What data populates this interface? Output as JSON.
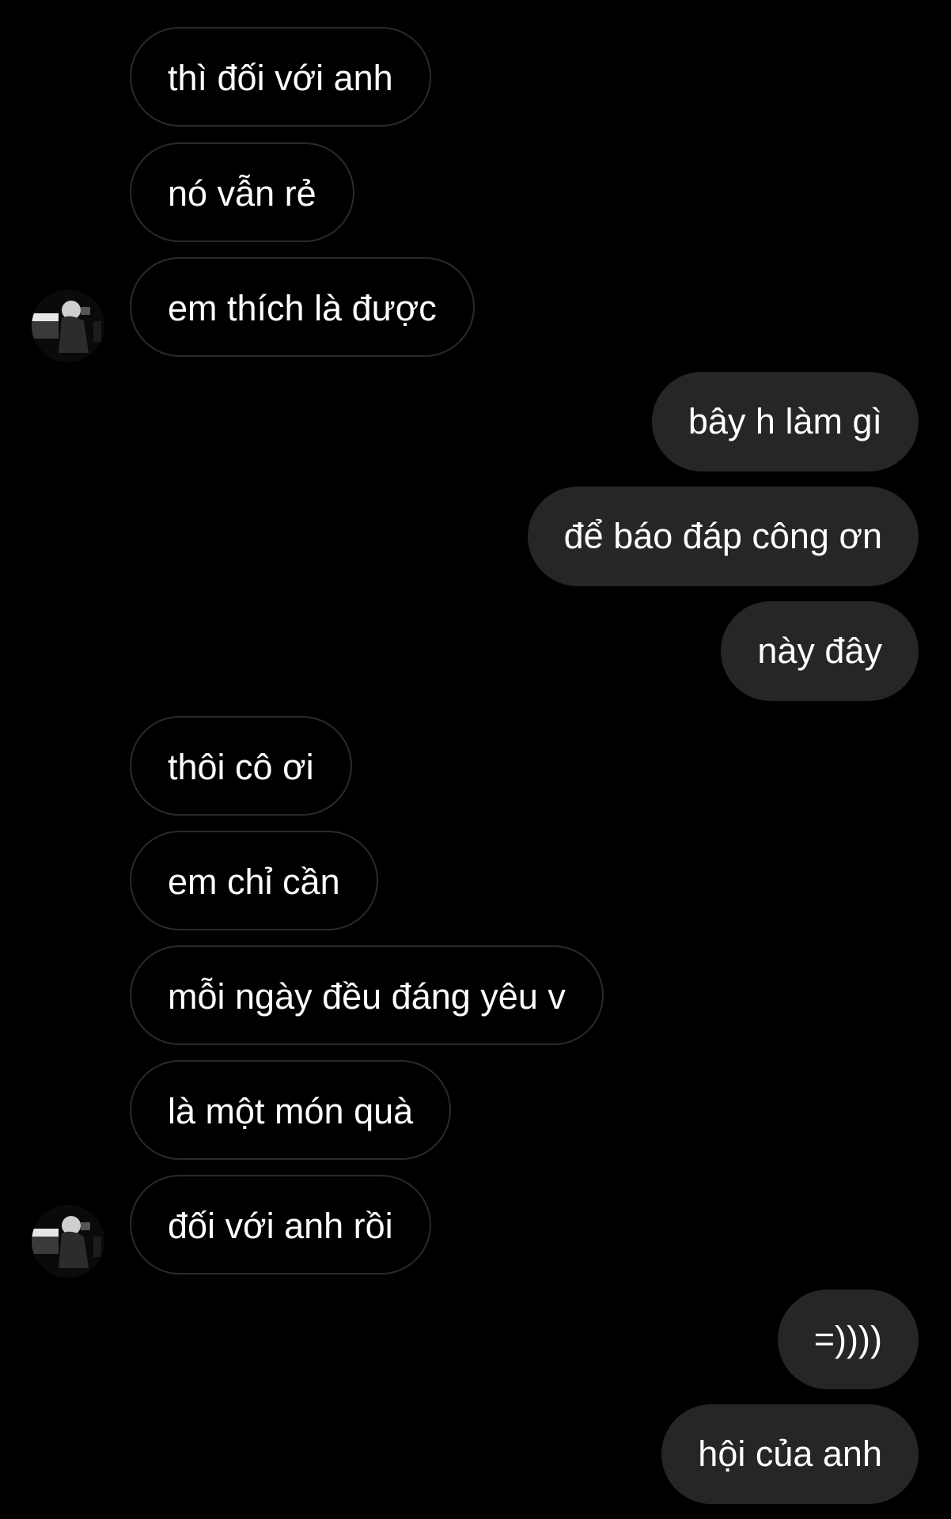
{
  "conversation": {
    "messages": [
      {
        "sender": "other",
        "text": "thì đối với anh"
      },
      {
        "sender": "other",
        "text": "nó vẫn rẻ"
      },
      {
        "sender": "other",
        "text": "em thích là được"
      },
      {
        "sender": "me",
        "text": "bây h làm gì"
      },
      {
        "sender": "me",
        "text": "để báo đáp công ơn"
      },
      {
        "sender": "me",
        "text": "này đây"
      },
      {
        "sender": "other",
        "text": "thôi cô ơi"
      },
      {
        "sender": "other",
        "text": "em chỉ cần"
      },
      {
        "sender": "other",
        "text": "mỗi ngày đều đáng yêu v"
      },
      {
        "sender": "other",
        "text": "là một món quà"
      },
      {
        "sender": "other",
        "text": "đối với anh rồi"
      },
      {
        "sender": "me",
        "text": "=))))"
      },
      {
        "sender": "me",
        "text": "hội của anh"
      }
    ]
  },
  "colors": {
    "background": "#000000",
    "incoming_bubble_border": "#2a2a2a",
    "outgoing_bubble": "#262626",
    "text": "#ffffff"
  },
  "icons": {
    "avatar": "contact-avatar-photo"
  }
}
